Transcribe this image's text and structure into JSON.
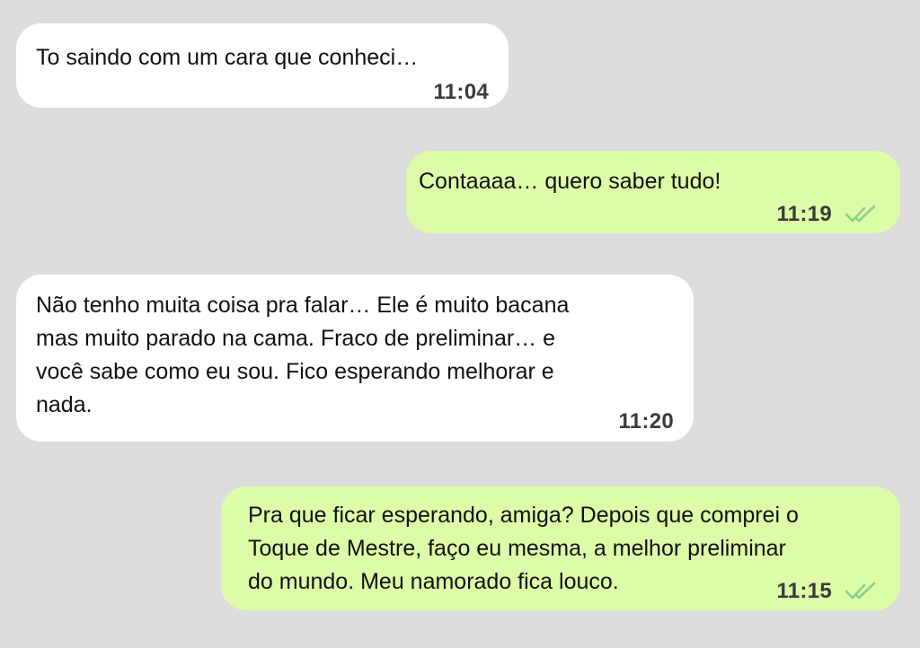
{
  "conversation": {
    "messages": [
      {
        "direction": "incoming",
        "text": "To saindo com um cara que conheci…",
        "time": "11:04"
      },
      {
        "direction": "outgoing",
        "text": "Contaaaa… quero saber tudo!",
        "time": "11:19",
        "status_icon": "double-check-read-icon"
      },
      {
        "direction": "incoming",
        "text": "Não tenho muita coisa pra falar… Ele é muito bacana\nmas muito parado na cama. Fraco de preliminar… e\nvocê sabe como eu sou. Fico esperando melhorar e\nnada.",
        "time": "11:20"
      },
      {
        "direction": "outgoing",
        "text": "Pra que ficar esperando, amiga? Depois que comprei o\nToque de Mestre, faço eu mesma, a melhor preliminar\ndo mundo. Meu namorado fica louco.",
        "time": "11:15",
        "status_icon": "double-check-read-icon"
      }
    ]
  },
  "colors": {
    "background": "#dddddd",
    "incoming_bubble": "#ffffff",
    "outgoing_bubble": "#dcfca8",
    "tick_color": "#8ccf8a"
  }
}
